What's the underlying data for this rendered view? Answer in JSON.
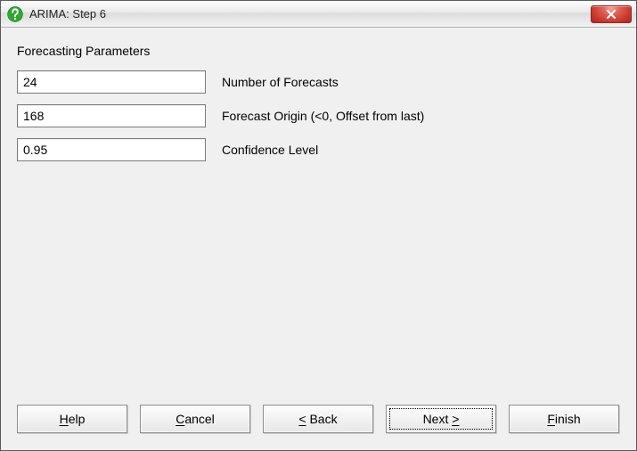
{
  "window": {
    "title": "ARIMA: Step 6"
  },
  "section": {
    "title": "Forecasting Parameters"
  },
  "fields": {
    "num_forecasts": {
      "value": "24",
      "label": "Number of Forecasts"
    },
    "origin": {
      "value": "168",
      "label": "Forecast Origin (<0, Offset from last)"
    },
    "confidence": {
      "value": "0.95",
      "label": "Confidence Level"
    }
  },
  "buttons": {
    "help": {
      "pre": "",
      "mn": "H",
      "post": "elp"
    },
    "cancel": {
      "pre": "",
      "mn": "C",
      "post": "ancel"
    },
    "back": {
      "pre": "",
      "mn": "<",
      "post": " Back"
    },
    "next": {
      "pre": "Next ",
      "mn": ">",
      "post": ""
    },
    "finish": {
      "pre": "",
      "mn": "F",
      "post": "inish"
    }
  }
}
